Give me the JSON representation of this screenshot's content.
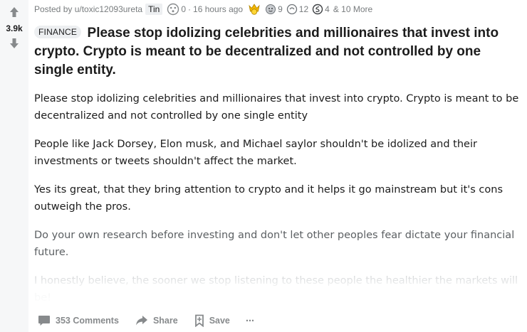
{
  "vote": {
    "score": "3.9k"
  },
  "meta": {
    "posted_by": "Posted by u/toxic12093ureta",
    "user_flair": "Tin",
    "karma_award_count": "0",
    "time_ago": "16 hours ago",
    "awards": [
      {
        "icon": "helpful-award-icon",
        "count": "9"
      },
      {
        "icon": "wholesome-award-icon",
        "count": "12"
      },
      {
        "icon": "moon-award-icon",
        "count": "4"
      }
    ],
    "more_awards": "& 10 More"
  },
  "post": {
    "flair": "FINANCE",
    "title": "Please stop idolizing celebrities and millionaires that invest into crypto. Crypto is meant to be decentralized and not controlled by one single entity.",
    "paragraphs": [
      "Please stop idolizing celebrities and millionaires that invest into crypto. Crypto is meant to be decentralized and not controlled by one single entity",
      "People like Jack Dorsey, Elon musk, and Michael saylor shouldn't be idolized and their investments or tweets shouldn't affect the market.",
      "Yes its great, that they bring attention to crypto and it helps it go mainstream but it's cons outweigh the pros.",
      "Do your own research before investing and don't let other peoples fear dictate your financial future.",
      "I honestly believe, the sooner we stop listening to these people the healthier the markets will be!"
    ]
  },
  "actions": {
    "comments": "353 Comments",
    "share": "Share",
    "save": "Save",
    "more": "···"
  },
  "colors": {
    "rail_bg": "#f6f7f8",
    "arrow": "#878a8c",
    "meta_text": "#787c7e",
    "flair_bg": "#edeff1"
  }
}
